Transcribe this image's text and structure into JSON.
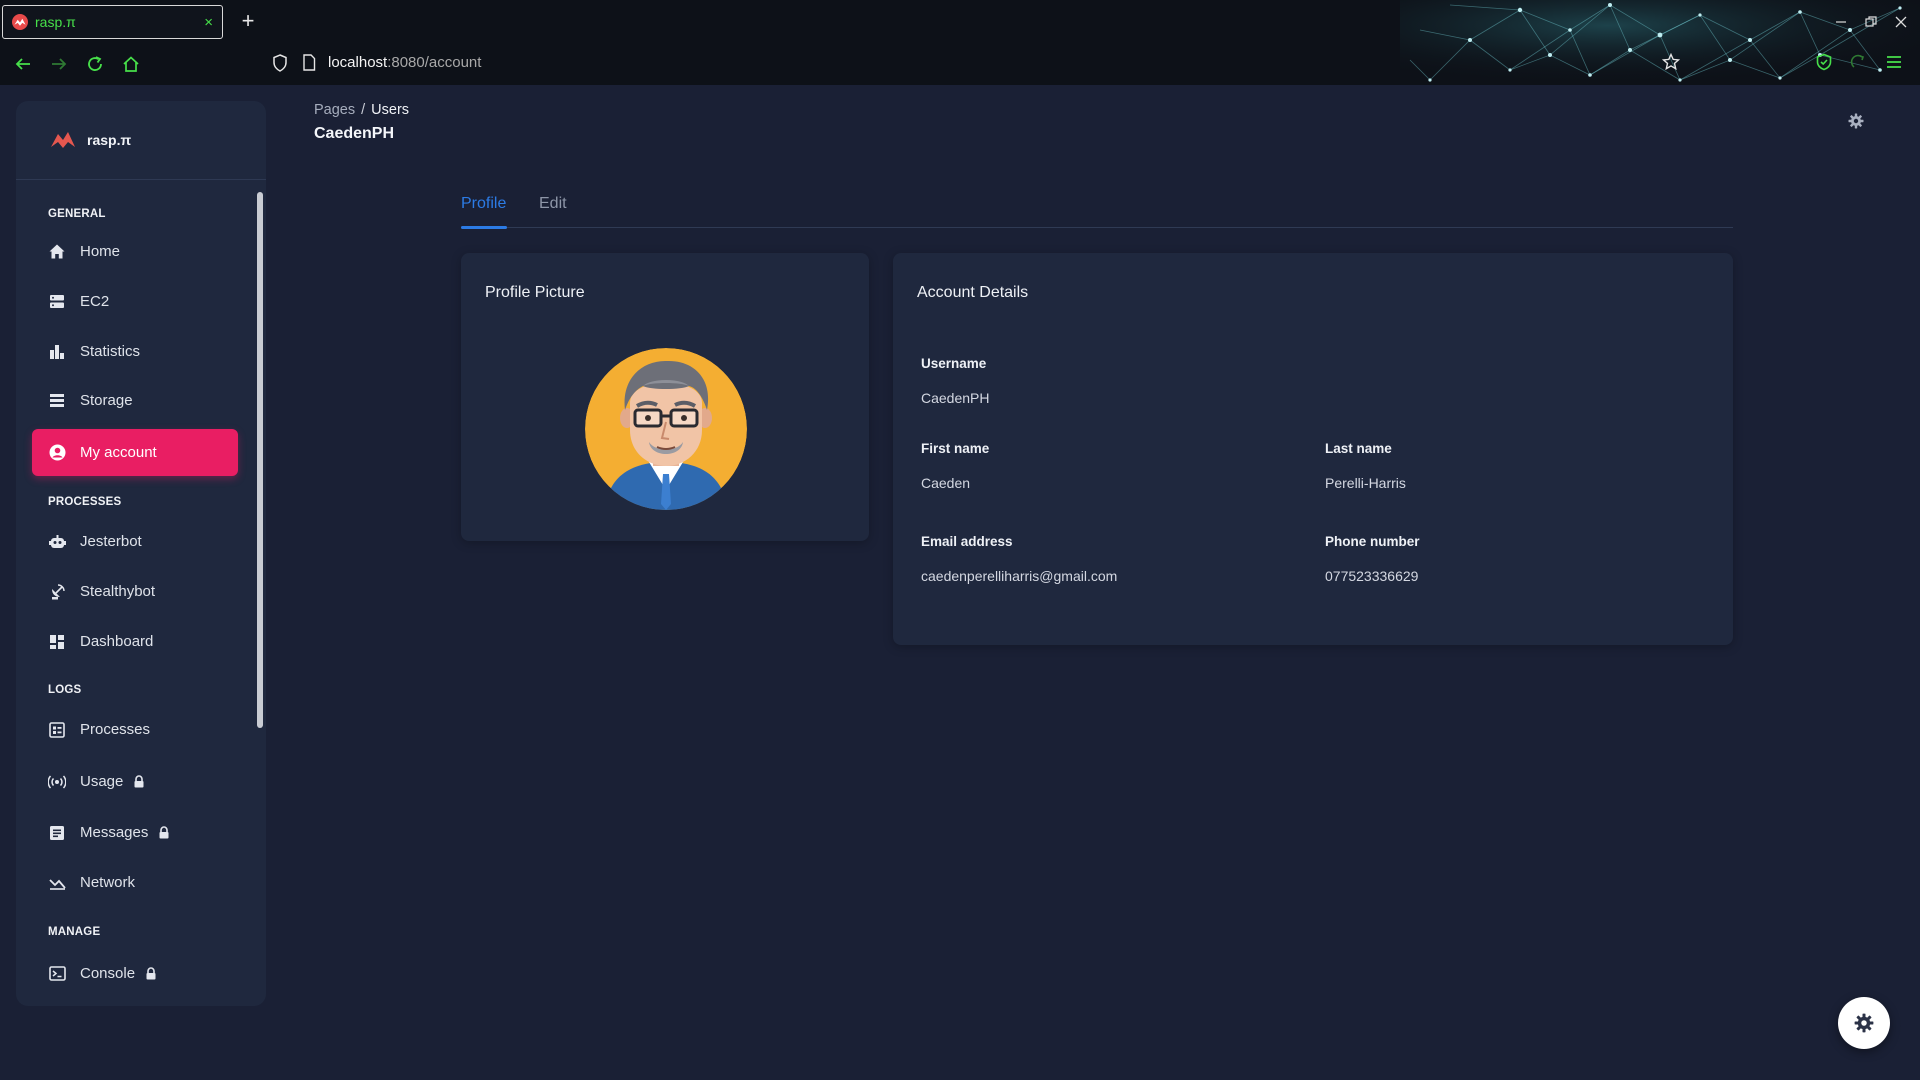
{
  "browser": {
    "tab_title": "rasp.π",
    "tab_close": "×",
    "new_tab": "+",
    "url_host": "localhost",
    "url_path": ":8080/account",
    "icons": [
      "back-arrow-icon",
      "forward-arrow-icon",
      "reload-icon",
      "home-icon",
      "shield-icon",
      "page-icon",
      "star-icon",
      "extension-icon",
      "menu-icon"
    ],
    "accent_color": "#47e04a"
  },
  "sidebar": {
    "brand": "rasp.π",
    "sections": [
      {
        "title": "GENERAL",
        "items": [
          {
            "label": "Home",
            "icon": "home-icon"
          },
          {
            "label": "EC2",
            "icon": "server-icon"
          },
          {
            "label": "Statistics",
            "icon": "bar-chart-icon"
          },
          {
            "label": "Storage",
            "icon": "storage-icon"
          },
          {
            "label": "My account",
            "icon": "account-circle-icon",
            "active": true
          }
        ]
      },
      {
        "title": "PROCESSES",
        "items": [
          {
            "label": "Jesterbot",
            "icon": "robot-icon"
          },
          {
            "label": "Stealthybot",
            "icon": "satellite-dish-icon"
          },
          {
            "label": "Dashboard",
            "icon": "dashboard-icon"
          }
        ]
      },
      {
        "title": "LOGS",
        "items": [
          {
            "label": "Processes",
            "icon": "list-icon"
          },
          {
            "label": "Usage",
            "icon": "broadcast-icon",
            "locked": true
          },
          {
            "label": "Messages",
            "icon": "message-icon",
            "locked": true
          },
          {
            "label": "Network",
            "icon": "network-chart-icon"
          }
        ]
      },
      {
        "title": "MANAGE",
        "items": [
          {
            "label": "Console",
            "icon": "terminal-icon",
            "locked": true
          }
        ]
      }
    ],
    "active_color": "#e91e63"
  },
  "header": {
    "breadcrumb": [
      "Pages",
      "Users"
    ],
    "breadcrumb_sep": "/",
    "title": "CaedenPH"
  },
  "tabs": {
    "profile": "Profile",
    "edit": "Edit",
    "active": "Profile",
    "accent": "#2c7be5"
  },
  "profile_card": {
    "title": "Profile Picture"
  },
  "account_card": {
    "title": "Account Details",
    "username_label": "Username",
    "username": "CaedenPH",
    "first_name_label": "First name",
    "first_name": "Caeden",
    "last_name_label": "Last name",
    "last_name": "Perelli-Harris",
    "email_label": "Email address",
    "email": "caedenperelliharris@gmail.com",
    "phone_label": "Phone number",
    "phone": "077523336629"
  }
}
